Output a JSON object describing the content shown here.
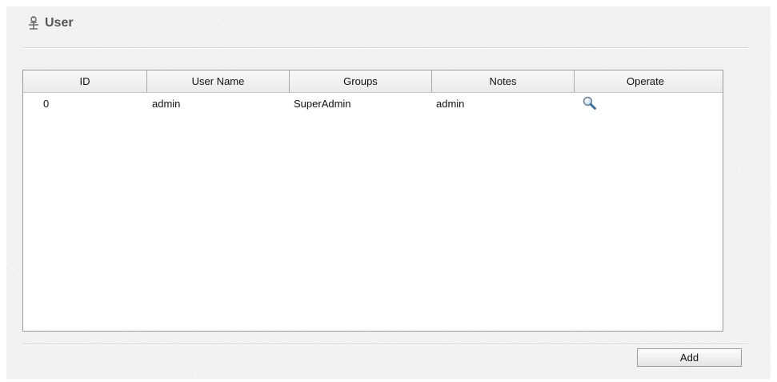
{
  "section": {
    "title": "User",
    "icon": "user-settings-icon"
  },
  "table": {
    "columns": [
      "ID",
      "User Name",
      "Groups",
      "Notes",
      "Operate"
    ],
    "rows": [
      {
        "id": "0",
        "user_name": "admin",
        "groups": "SuperAdmin",
        "notes": "admin",
        "operate_icon": "search-icon"
      }
    ]
  },
  "footer": {
    "add_label": "Add"
  }
}
